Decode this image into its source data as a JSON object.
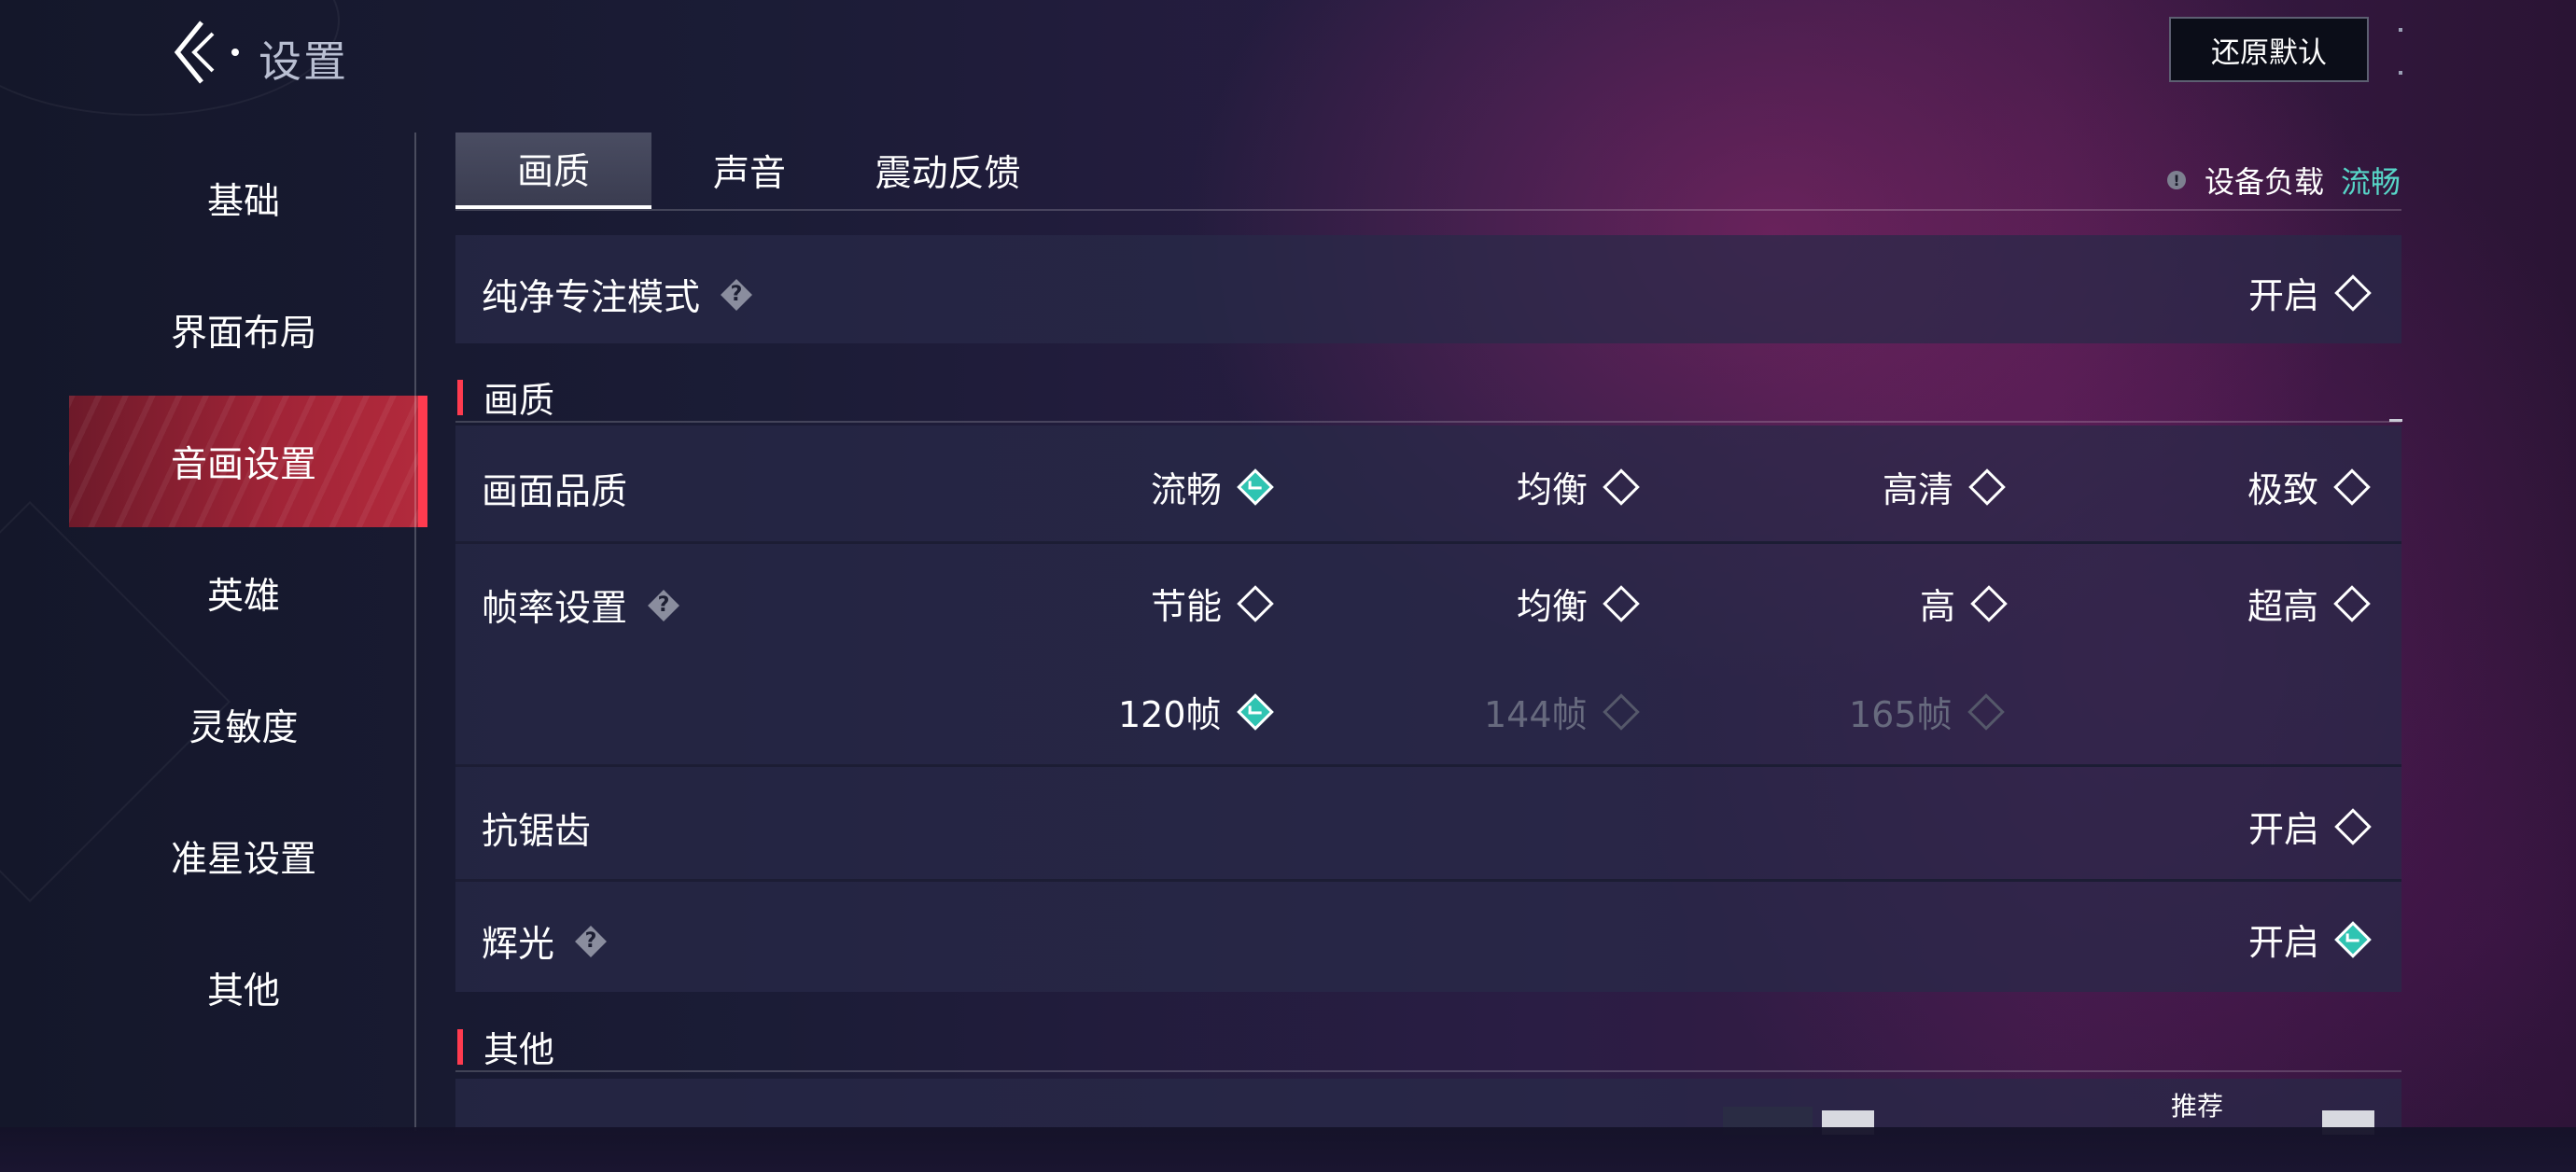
{
  "header": {
    "title": "设置",
    "reset_label": "还原默认"
  },
  "sidebar": {
    "items": [
      {
        "label": "基础"
      },
      {
        "label": "界面布局"
      },
      {
        "label": "音画设置"
      },
      {
        "label": "英雄"
      },
      {
        "label": "灵敏度"
      },
      {
        "label": "准星设置"
      },
      {
        "label": "其他"
      }
    ],
    "active_index": 2
  },
  "tabs": [
    {
      "label": "画质"
    },
    {
      "label": "声音"
    },
    {
      "label": "震动反馈"
    }
  ],
  "device_load": {
    "label": "设备负载",
    "value": "流畅"
  },
  "focus_mode": {
    "label": "纯净专注模式",
    "option": "开启",
    "checked": false
  },
  "section_quality": "画质",
  "quality": {
    "label": "画面品质",
    "options": [
      {
        "label": "流畅",
        "checked": true
      },
      {
        "label": "均衡",
        "checked": false
      },
      {
        "label": "高清",
        "checked": false
      },
      {
        "label": "极致",
        "checked": false
      }
    ]
  },
  "framerate": {
    "label": "帧率设置",
    "options": [
      {
        "label": "节能",
        "checked": false
      },
      {
        "label": "均衡",
        "checked": false
      },
      {
        "label": "高",
        "checked": false
      },
      {
        "label": "超高",
        "checked": false
      }
    ],
    "options2": [
      {
        "label": "120帧",
        "checked": true,
        "disabled": false
      },
      {
        "label": "144帧",
        "checked": false,
        "disabled": true
      },
      {
        "label": "165帧",
        "checked": false,
        "disabled": true
      }
    ]
  },
  "antialias": {
    "label": "抗锯齿",
    "option": "开启",
    "checked": false
  },
  "glow": {
    "label": "辉光",
    "option": "开启",
    "checked": true
  },
  "section_other": "其他",
  "bottom_row": {
    "recommend": "推荐"
  },
  "colors": {
    "accent_red": "#ff3b4f",
    "accent_teal": "#2fc4b2",
    "load_value": "#57d6c8"
  },
  "icons": {
    "back": "back-chevron-icon",
    "help": "help-icon",
    "warn": "warning-icon"
  }
}
